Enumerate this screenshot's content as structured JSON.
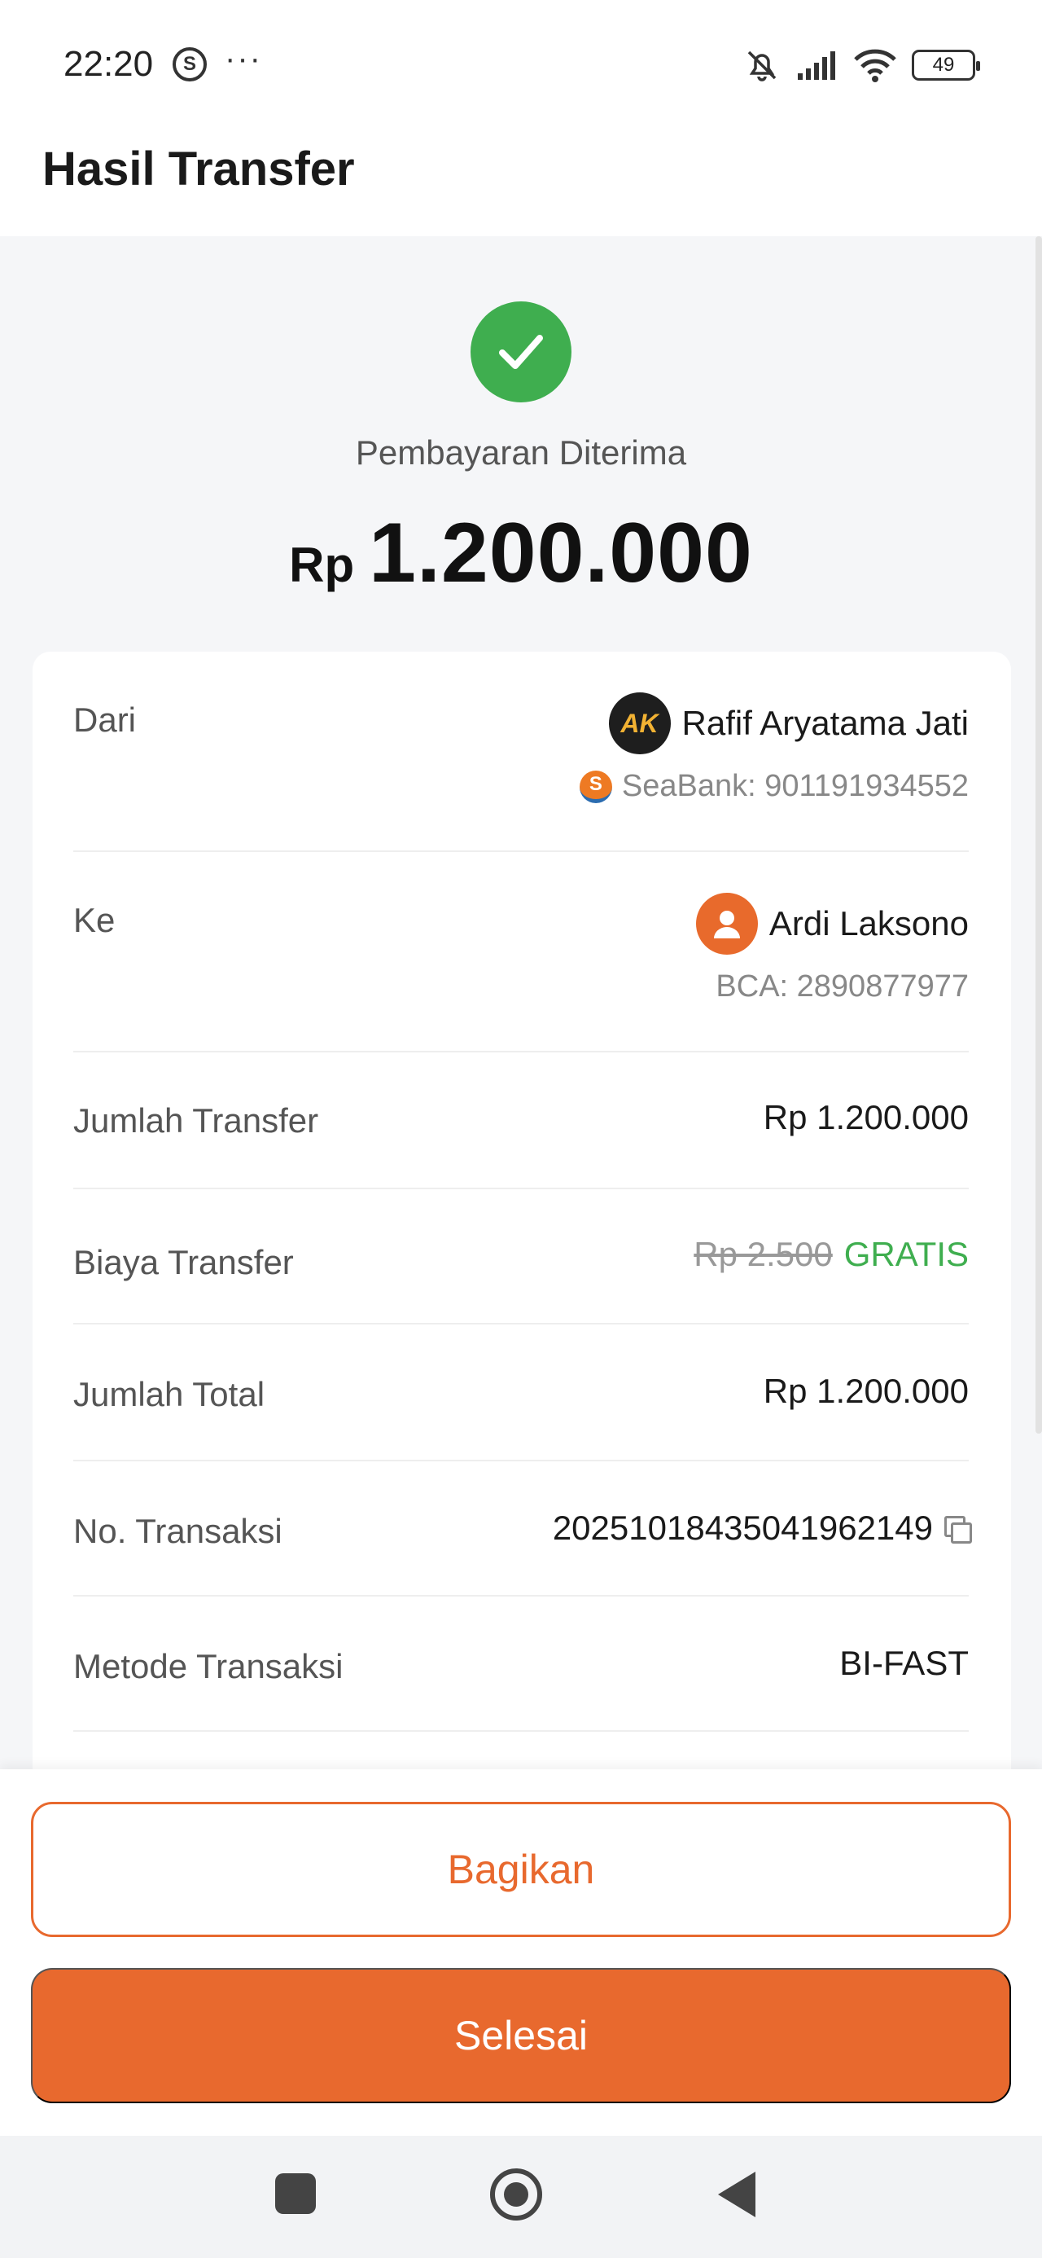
{
  "status_bar": {
    "time": "22:20",
    "app_icon_letter": "S",
    "dots": "···",
    "battery": "49"
  },
  "header": {
    "title": "Hasil Transfer"
  },
  "result": {
    "status": "Pembayaran Diterima",
    "currency": "Rp",
    "amount": "1.200.000",
    "status_color": "#3fae4f"
  },
  "details": {
    "from": {
      "label": "Dari",
      "avatar_text": "AK",
      "name": "Rafif Aryatama Jati",
      "bank_logo_letter": "S",
      "account": "SeaBank: 901191934552"
    },
    "to": {
      "label": "Ke",
      "name": "Ardi Laksono",
      "account": "BCA: 2890877977"
    },
    "transfer_amount": {
      "label": "Jumlah Transfer",
      "value": "Rp 1.200.000"
    },
    "transfer_fee": {
      "label": "Biaya Transfer",
      "original": "Rp 2.500",
      "value": "GRATIS"
    },
    "total": {
      "label": "Jumlah Total",
      "value": "Rp 1.200.000"
    },
    "transaction_no": {
      "label": "No. Transaksi",
      "value": "20251018435041962149"
    },
    "method": {
      "label": "Metode Transaksi",
      "value": "BI-FAST"
    }
  },
  "actions": {
    "share": "Bagikan",
    "done": "Selesai",
    "accent_color": "#e8692e"
  }
}
